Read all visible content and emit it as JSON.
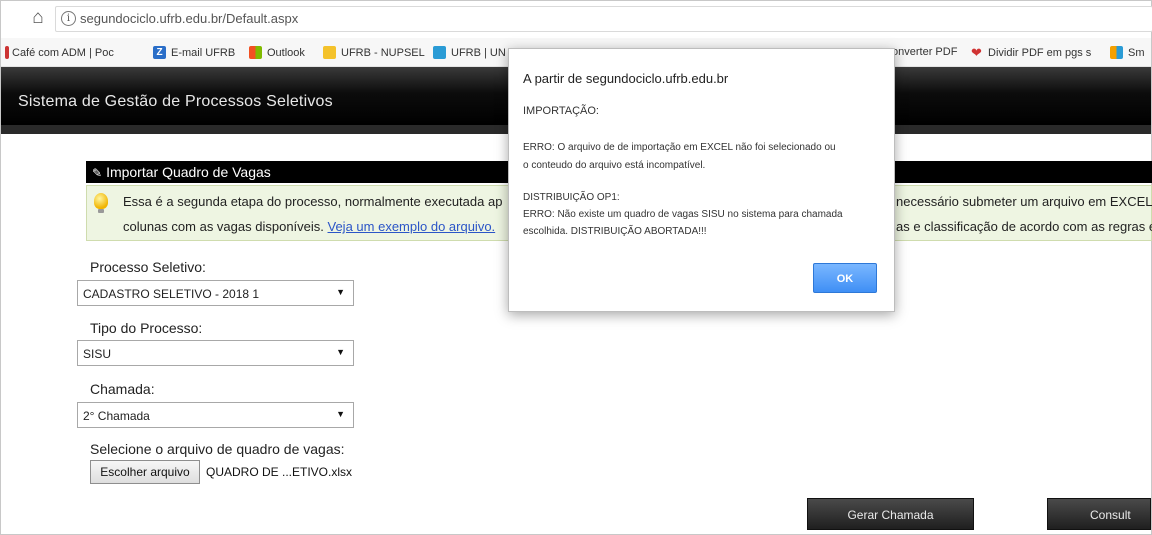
{
  "browser": {
    "url": "segundociclo.ufrb.edu.br/Default.aspx",
    "bookmarks": [
      {
        "label": "Café com ADM | Poc",
        "color": "#cc3333"
      },
      {
        "label": "E-mail UFRB",
        "color": "#2a6ec8",
        "letter": "Z"
      },
      {
        "label": "Outlook",
        "color": "#f25022"
      },
      {
        "label": "UFRB - NUPSEL",
        "color": "#f4c22b"
      },
      {
        "label": "UFRB | UN",
        "color": "#2a9bd5"
      },
      {
        "label": "onverter PDF",
        "color": ""
      },
      {
        "label": "Dividir PDF em pgs s",
        "color": "#d03333"
      },
      {
        "label": "Sm",
        "color": "#f4a000"
      }
    ]
  },
  "app": {
    "title": "Sistema de Gestão de Processos Seletivos"
  },
  "panel": {
    "title": "Importar Quadro de Vagas",
    "info_line1_left": "Essa é a segunda etapa do processo, normalmente executada ap",
    "info_line2_left": "colunas com as vagas disponíveis. ",
    "info_link": "Veja um exemplo do arquivo.",
    "info_line1_right": "necessário submeter um arquivo em EXCEL",
    "info_line2_right": "as e classificação de acordo com as regras e"
  },
  "form": {
    "processo_label": "Processo Seletivo:",
    "processo_value": "CADASTRO SELETIVO - 2018 1",
    "tipo_label": "Tipo do Processo:",
    "tipo_value": "SISU",
    "chamada_label": "Chamada:",
    "chamada_value": "2° Chamada",
    "arquivo_label": "Selecione o arquivo de quadro de vagas:",
    "file_button": "Escolher arquivo",
    "file_name": "QUADRO DE ...ETIVO.xlsx",
    "gerar_button": "Gerar Chamada",
    "consultar_button": "Consult"
  },
  "dialog": {
    "title": "A partir de segundociclo.ufrb.edu.br",
    "lines": [
      "IMPORTAÇÃO:",
      "ERRO: O arquivo de de importação em EXCEL não foi selecionado ou",
      "o conteudo do arquivo está incompatível.",
      "DISTRIBUIÇÃO OP1:",
      "ERRO: Não existe um quadro de vagas SISU no sistema para chamada",
      "escolhida. DISTRIBUIÇÃO ABORTADA!!!"
    ],
    "ok": "OK"
  }
}
